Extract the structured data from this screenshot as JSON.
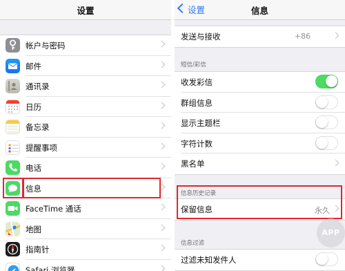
{
  "left": {
    "title": "设置",
    "items": [
      {
        "label": "帐户与密码",
        "icon": "key-icon"
      },
      {
        "label": "邮件",
        "icon": "mail-icon"
      },
      {
        "label": "通讯录",
        "icon": "contacts-icon"
      },
      {
        "label": "日历",
        "icon": "calendar-icon"
      },
      {
        "label": "备忘录",
        "icon": "notes-icon"
      },
      {
        "label": "提醒事项",
        "icon": "reminders-icon"
      },
      {
        "label": "电话",
        "icon": "phone-icon"
      },
      {
        "label": "信息",
        "icon": "messages-icon"
      },
      {
        "label": "FaceTime 通话",
        "icon": "facetime-icon"
      },
      {
        "label": "地图",
        "icon": "maps-icon"
      },
      {
        "label": "指南针",
        "icon": "compass-icon"
      },
      {
        "label": "Safari 浏览器",
        "icon": "safari-icon"
      }
    ]
  },
  "right": {
    "back_label": "设置",
    "title": "信息",
    "send_receive": {
      "label": "发送与接收",
      "value": "+86"
    },
    "sms_header": "短信/彩信",
    "sms_items": [
      {
        "label": "收发彩信",
        "toggle": "on"
      },
      {
        "label": "群组信息",
        "toggle": "off"
      },
      {
        "label": "显示主题栏",
        "toggle": "off"
      },
      {
        "label": "字符计数",
        "toggle": "off"
      },
      {
        "label": "黑名单",
        "toggle": null
      }
    ],
    "history_header": "信息历史记录",
    "keep_messages": {
      "label": "保留信息",
      "value": "永久"
    },
    "filter_header": "信息过滤",
    "filter_items": [
      {
        "label": "过滤未知发件人",
        "toggle": "off"
      }
    ]
  },
  "watermark": "APP",
  "colors": {
    "highlight": "#e0262d",
    "toggle_on": "#4cd964",
    "link": "#2f7cf6"
  }
}
